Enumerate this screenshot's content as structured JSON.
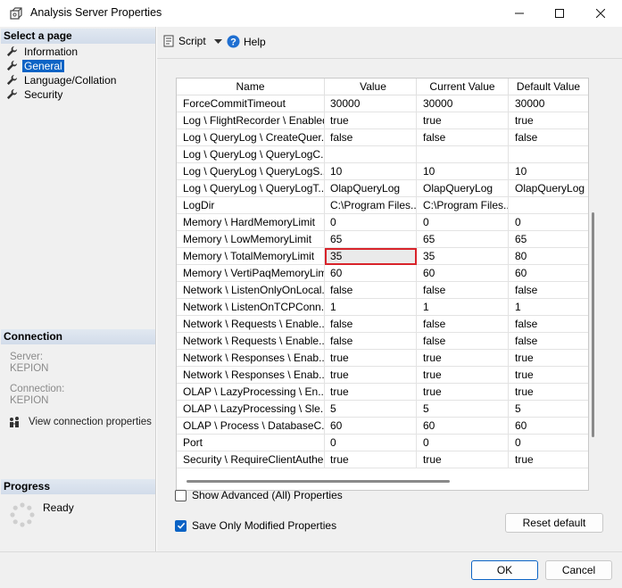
{
  "window": {
    "title": "Analysis Server Properties"
  },
  "sidebar": {
    "select_header": "Select a page",
    "items": [
      {
        "label": "Information",
        "active": false
      },
      {
        "label": "General",
        "active": true
      },
      {
        "label": "Language/Collation",
        "active": false
      },
      {
        "label": "Security",
        "active": false
      }
    ],
    "connection_header": "Connection",
    "server_label": "Server:",
    "server_value": "KEPION",
    "connection_label": "Connection:",
    "connection_value": "KEPION",
    "view_connection": "View connection properties",
    "progress_header": "Progress",
    "progress_status": "Ready"
  },
  "toolbar": {
    "script_label": "Script",
    "help_label": "Help"
  },
  "grid": {
    "columns": [
      "Name",
      "Value",
      "Current Value",
      "Default Value"
    ],
    "rows": [
      [
        "ForceCommitTimeout",
        "30000",
        "30000",
        "30000"
      ],
      [
        "Log \\ FlightRecorder \\ Enabled",
        "true",
        "true",
        "true"
      ],
      [
        "Log \\ QueryLog \\ CreateQuer...",
        "false",
        "false",
        "false"
      ],
      [
        "Log \\ QueryLog \\ QueryLogC...",
        "",
        "",
        ""
      ],
      [
        "Log \\ QueryLog \\ QueryLogS...",
        "10",
        "10",
        "10"
      ],
      [
        "Log \\ QueryLog \\ QueryLogT...",
        "OlapQueryLog",
        "OlapQueryLog",
        "OlapQueryLog"
      ],
      [
        "LogDir",
        "C:\\Program Files...",
        "C:\\Program Files...",
        ""
      ],
      [
        "Memory \\ HardMemoryLimit",
        "0",
        "0",
        "0"
      ],
      [
        "Memory \\ LowMemoryLimit",
        "65",
        "65",
        "65"
      ],
      [
        "Memory \\ TotalMemoryLimit",
        "35",
        "35",
        "80"
      ],
      [
        "Memory \\ VertiPaqMemoryLimit",
        "60",
        "60",
        "60"
      ],
      [
        "Network \\ ListenOnlyOnLocal...",
        "false",
        "false",
        "false"
      ],
      [
        "Network \\ ListenOnTCPConn...",
        "1",
        "1",
        "1"
      ],
      [
        "Network \\ Requests \\ Enable...",
        "false",
        "false",
        "false"
      ],
      [
        "Network \\ Requests \\ Enable...",
        "false",
        "false",
        "false"
      ],
      [
        "Network \\ Responses \\ Enab...",
        "true",
        "true",
        "true"
      ],
      [
        "Network \\ Responses \\ Enab...",
        "true",
        "true",
        "true"
      ],
      [
        "OLAP \\ LazyProcessing \\ En...",
        "true",
        "true",
        "true"
      ],
      [
        "OLAP \\ LazyProcessing \\ Sle...",
        "5",
        "5",
        "5"
      ],
      [
        "OLAP \\ Process \\ DatabaseC...",
        "60",
        "60",
        "60"
      ],
      [
        "Port",
        "0",
        "0",
        "0"
      ],
      [
        "Security \\ RequireClientAuthe...",
        "true",
        "true",
        "true"
      ]
    ],
    "selected_row": 9,
    "selected_col": 1
  },
  "options": {
    "show_advanced": "Show Advanced (All) Properties",
    "show_advanced_checked": false,
    "save_only_modified": "Save Only Modified Properties",
    "save_only_modified_checked": true
  },
  "buttons": {
    "reset_default": "Reset default",
    "ok": "OK",
    "cancel": "Cancel"
  },
  "colors": {
    "accent": "#0b63c5",
    "selection_outline": "#d8232a"
  }
}
